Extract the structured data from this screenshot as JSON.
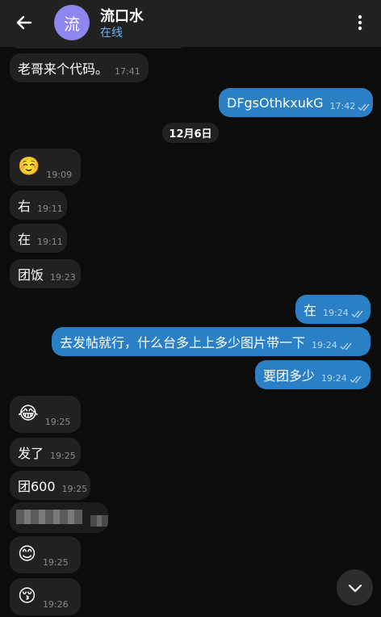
{
  "header": {
    "contact_name": "流口水",
    "avatar_letter": "流",
    "status": "在线",
    "back_icon": "arrow-left-icon",
    "menu_icon": "more-vertical-icon"
  },
  "date_separator": "12月6日",
  "messages": [
    {
      "dir": "in",
      "text": "老哥来个代码。",
      "time": "17:41"
    },
    {
      "dir": "out",
      "text": "DFgsOthkxukG",
      "time": "17:42",
      "read": true
    },
    {
      "dir": "in",
      "text": "☺️",
      "time": "19:09"
    },
    {
      "dir": "in",
      "text": "右",
      "time": "19:11"
    },
    {
      "dir": "in",
      "text": "在",
      "time": "19:11"
    },
    {
      "dir": "in",
      "text": "团饭",
      "time": "19:23"
    },
    {
      "dir": "out",
      "text": "在",
      "time": "19:24",
      "read": true
    },
    {
      "dir": "out",
      "text": "去发帖就行，什么台多上上多少图片带一下",
      "time": "19:24",
      "read": true
    },
    {
      "dir": "out",
      "text": "要团多少",
      "time": "19:24",
      "read": true
    },
    {
      "dir": "in",
      "text": "😂",
      "time": "19:25"
    },
    {
      "dir": "in",
      "text": "发了",
      "time": "19:25"
    },
    {
      "dir": "in",
      "text": "团600",
      "time": "19:25"
    },
    {
      "dir": "in",
      "text": "😊",
      "time": "19:25"
    },
    {
      "dir": "in",
      "text": "😚",
      "time": "19:26"
    }
  ],
  "scroll_down_icon": "chevron-down-icon",
  "colors": {
    "background": "#0c0c0c",
    "incoming_bubble": "#212121",
    "outgoing_bubble": "#2b80c5",
    "accent": "#6ab2f2",
    "avatar": "#8e85ee"
  }
}
